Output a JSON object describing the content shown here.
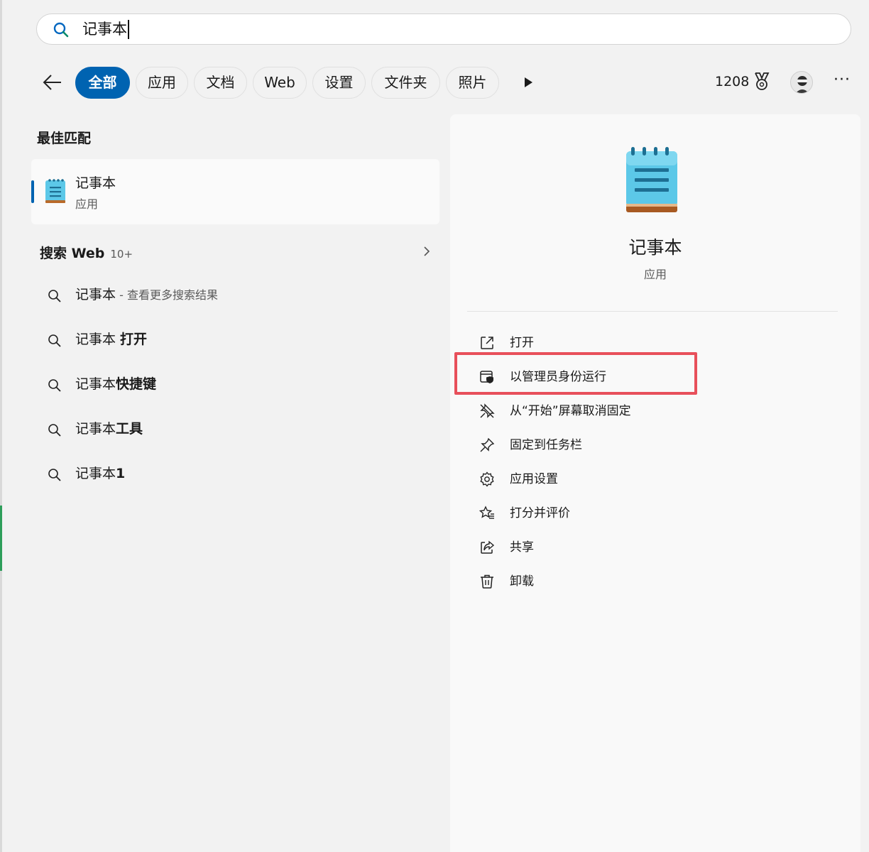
{
  "search": {
    "query": "记事本"
  },
  "filters": {
    "items": [
      "全部",
      "应用",
      "文档",
      "Web",
      "设置",
      "文件夹",
      "照片"
    ],
    "active": "全部"
  },
  "header": {
    "points": "1208"
  },
  "best_match": {
    "section_title": "最佳匹配",
    "name": "记事本",
    "type": "应用"
  },
  "web_search": {
    "title": "搜索 Web",
    "count": "10+",
    "results": [
      {
        "main": "记事本",
        "bold": "",
        "suffix": " - 查看更多搜索结果"
      },
      {
        "main": "记事本 ",
        "bold": "打开",
        "suffix": ""
      },
      {
        "main": "记事本",
        "bold": "快捷键",
        "suffix": ""
      },
      {
        "main": "记事本",
        "bold": "工具",
        "suffix": ""
      },
      {
        "main": "记事本",
        "bold": "1",
        "suffix": ""
      }
    ]
  },
  "detail": {
    "name": "记事本",
    "type": "应用",
    "actions": [
      {
        "label": "打开",
        "icon": "open-external-icon"
      },
      {
        "label": "以管理员身份运行",
        "icon": "shield-window-icon"
      },
      {
        "label": "从“开始”屏幕取消固定",
        "icon": "unpin-icon"
      },
      {
        "label": "固定到任务栏",
        "icon": "pin-icon"
      },
      {
        "label": "应用设置",
        "icon": "gear-icon"
      },
      {
        "label": "打分并评价",
        "icon": "star-list-icon"
      },
      {
        "label": "共享",
        "icon": "share-icon"
      },
      {
        "label": "卸载",
        "icon": "trash-icon"
      }
    ]
  },
  "colors": {
    "accent": "#0063b1",
    "highlight": "#e8505b"
  }
}
